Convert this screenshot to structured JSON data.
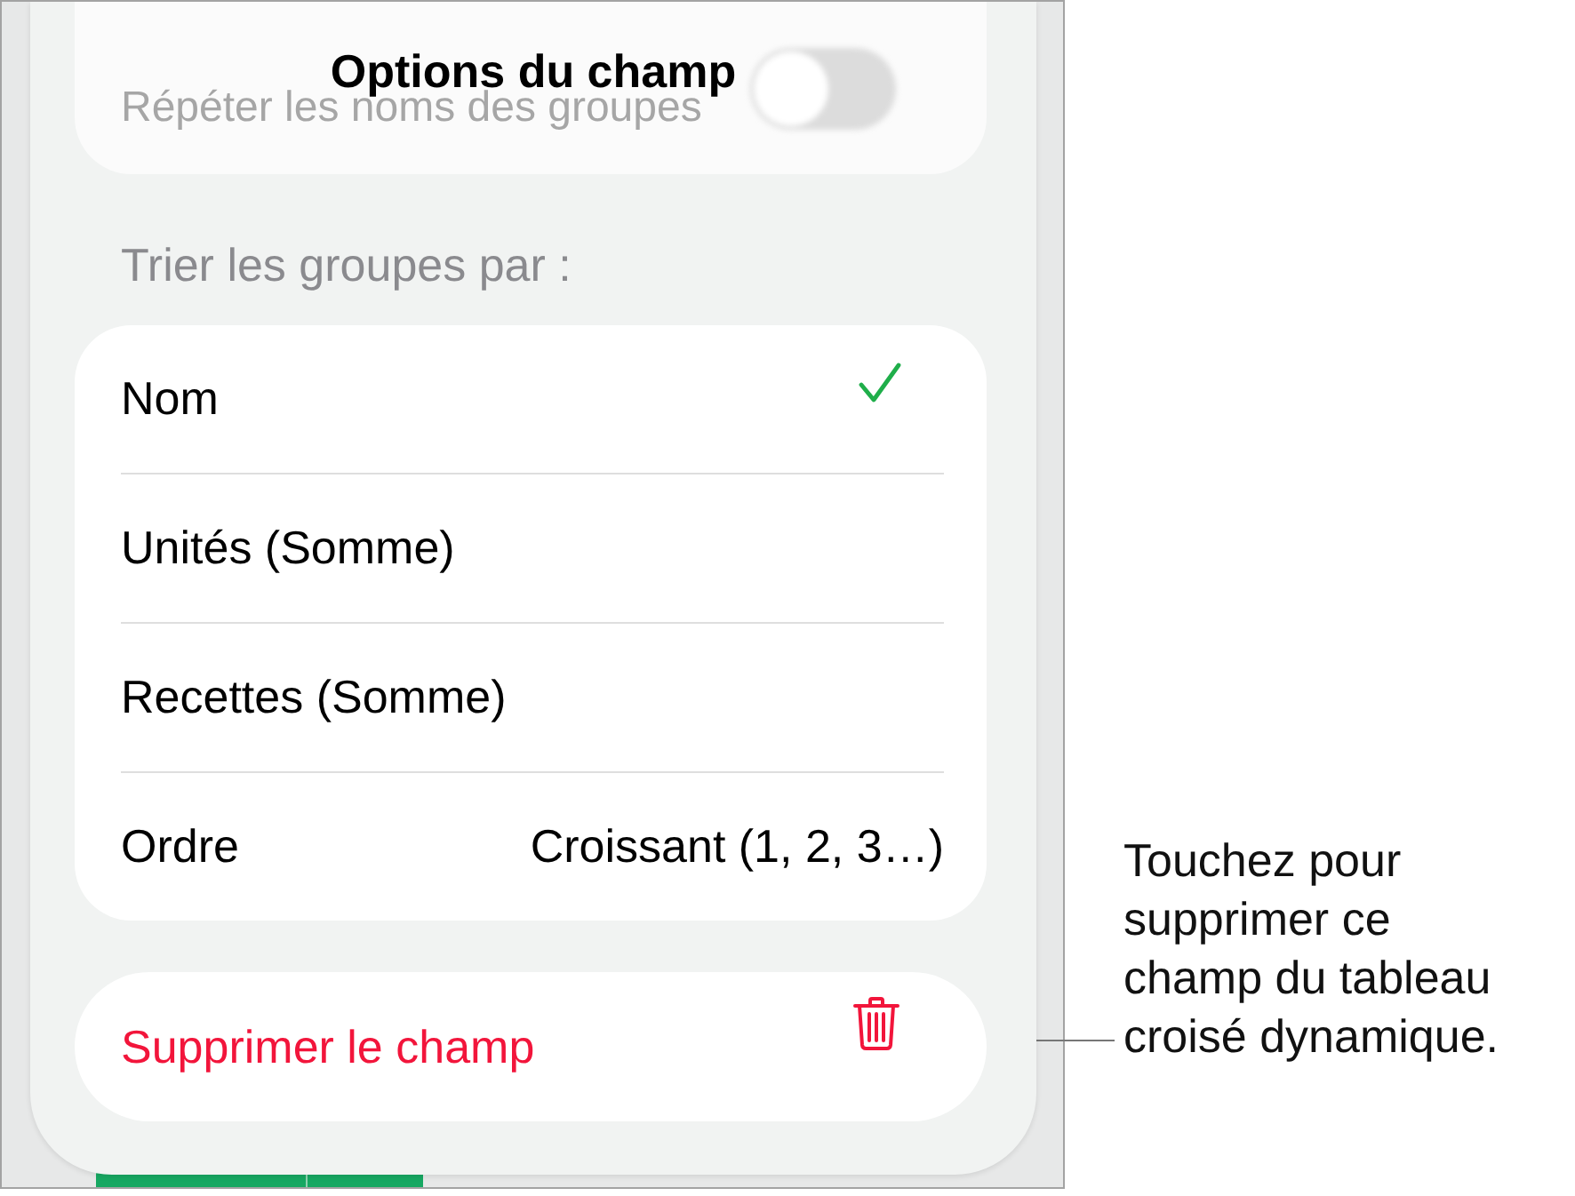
{
  "sheet": {
    "title": "Options du champ"
  },
  "background_setting": {
    "label": "Répéter les noms des groupes",
    "on": false
  },
  "sort_section": {
    "heading": "Trier les groupes par :",
    "options": [
      {
        "label": "Nom",
        "selected": true
      },
      {
        "label": "Unités (Somme)",
        "selected": false
      },
      {
        "label": "Recettes (Somme)",
        "selected": false
      }
    ],
    "order": {
      "label": "Ordre",
      "value": "Croissant (1, 2, 3…)"
    }
  },
  "delete_button": {
    "label": "Supprimer le champ"
  },
  "callout": {
    "text": "Touchez pour\nsupprimer ce\nchamp du tableau\ncroisé dynamique."
  }
}
